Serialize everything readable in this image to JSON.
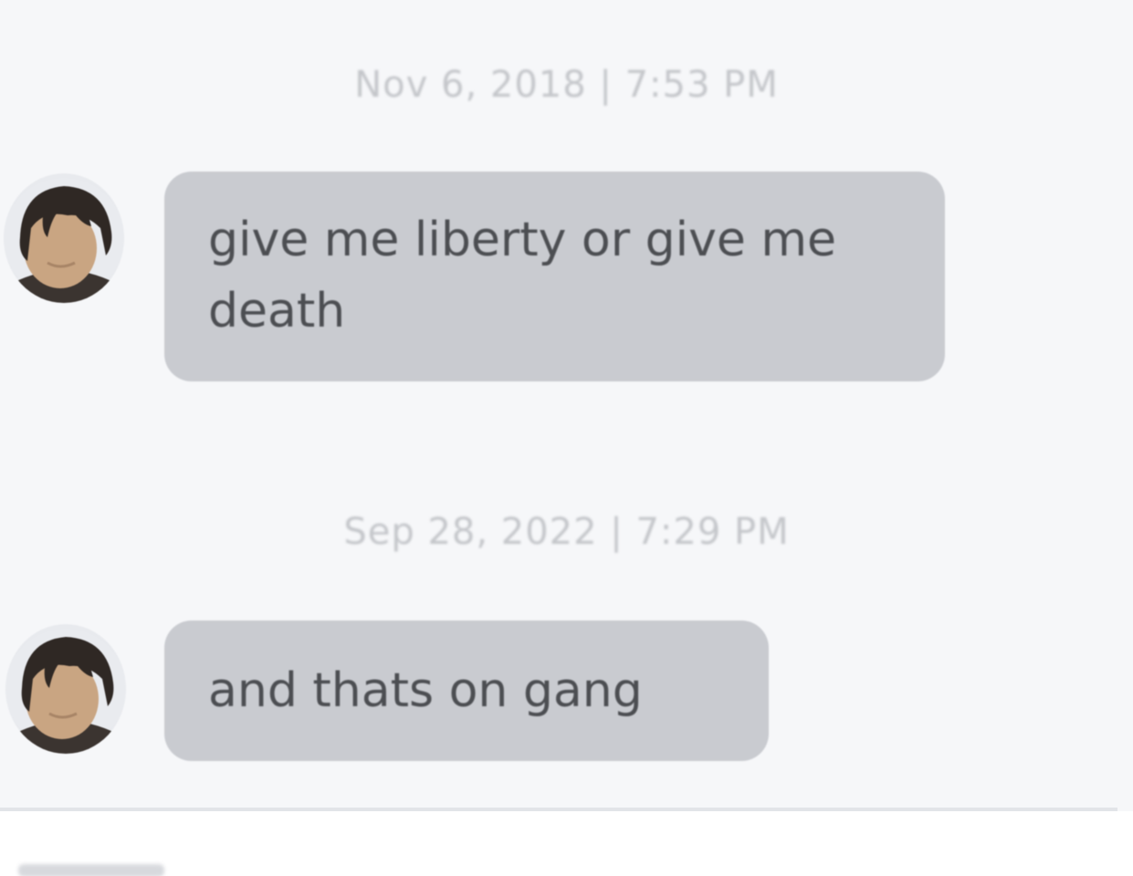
{
  "messages": [
    {
      "timestamp": "Nov 6, 2018 | 7:53 PM",
      "text": "give me liberty or give me death"
    },
    {
      "timestamp": "Sep 28, 2022 | 7:29 PM",
      "text": "and thats on gang"
    }
  ],
  "colors": {
    "background": "#f6f7f9",
    "bubble": "#c9cbd0",
    "bubble_text": "#4c4e52",
    "timestamp": "#c4c6ca"
  },
  "icons": {
    "avatar": "person-avatar-icon"
  }
}
